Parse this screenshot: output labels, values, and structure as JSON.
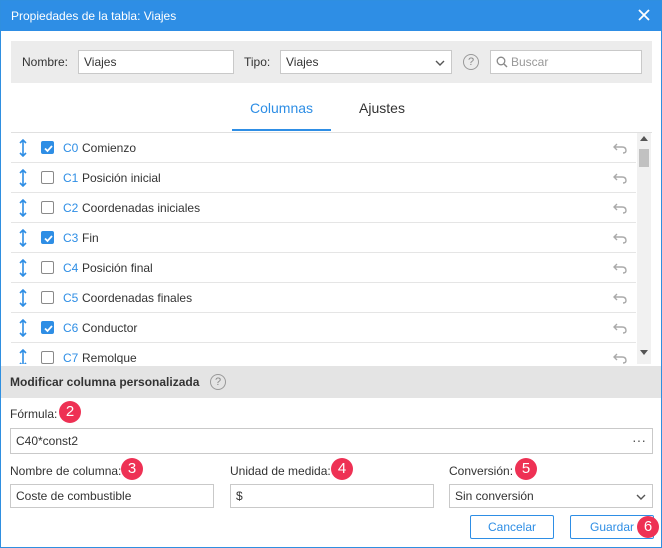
{
  "window": {
    "title": "Propiedades de la tabla: Viajes"
  },
  "filter": {
    "name_label": "Nombre:",
    "name_value": "Viajes",
    "type_label": "Tipo:",
    "type_value": "Viajes",
    "help": "?",
    "search_placeholder": "Buscar"
  },
  "tabs": [
    {
      "label": "Columnas",
      "active": true
    },
    {
      "label": "Ajustes",
      "active": false
    }
  ],
  "columns": [
    {
      "code": "C0",
      "name": "Comienzo",
      "checked": true
    },
    {
      "code": "C1",
      "name": "Posición inicial",
      "checked": false
    },
    {
      "code": "C2",
      "name": "Coordenadas iniciales",
      "checked": false
    },
    {
      "code": "C3",
      "name": "Fin",
      "checked": true
    },
    {
      "code": "C4",
      "name": "Posición final",
      "checked": false
    },
    {
      "code": "C5",
      "name": "Coordenadas finales",
      "checked": false
    },
    {
      "code": "C6",
      "name": "Conductor",
      "checked": true
    },
    {
      "code": "C7",
      "name": "Remolque",
      "checked": false
    }
  ],
  "custom": {
    "section_title": "Modificar columna personalizada",
    "help": "?",
    "formula_label": "Fórmula:",
    "formula_value": "C40*const2",
    "formula_more": "···",
    "colname_label": "Nombre de columna:",
    "colname_value": "Coste de combustible",
    "unit_label": "Unidad de medida:",
    "unit_value": "$",
    "conversion_label": "Conversión:",
    "conversion_value": "Sin conversión"
  },
  "badges": {
    "b2": "2",
    "b3": "3",
    "b4": "4",
    "b5": "5",
    "b6": "6"
  },
  "buttons": {
    "cancel": "Cancelar",
    "save": "Guardar"
  },
  "colors": {
    "accent": "#2e8ee5",
    "badge": "#ee3154",
    "section_bg": "#e4e4e4"
  }
}
